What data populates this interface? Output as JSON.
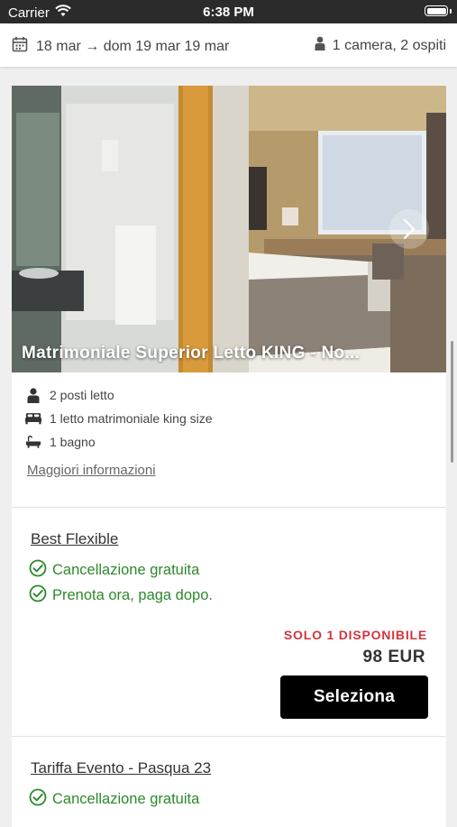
{
  "status_bar": {
    "carrier": "Carrier",
    "time": "6:38 PM"
  },
  "search": {
    "dates": "18 mar → dom 19 mar 19 mar",
    "guests": "1 camera, 2 ospiti"
  },
  "room": {
    "title": "Matrimoniale Superior Letto KING - No...",
    "features": [
      {
        "icon": "person-icon",
        "text": "2 posti letto"
      },
      {
        "icon": "bed-icon",
        "text": "1 letto matrimoniale king size"
      },
      {
        "icon": "bathtub-icon",
        "text": "1 bagno"
      }
    ],
    "more_info": "Maggiori informazioni"
  },
  "rates": [
    {
      "name": "Best Flexible",
      "benefits": [
        "Cancellazione gratuita",
        "Prenota ora, paga dopo."
      ],
      "availability": "SOLO 1 DISPONIBILE",
      "price": "98 EUR",
      "select_label": "Seleziona"
    },
    {
      "name": "Tariffa Evento - Pasqua 23",
      "benefits": [
        "Cancellazione gratuita"
      ]
    }
  ],
  "colors": {
    "accent_green": "#2c8a2c",
    "availability_red": "#d0363f",
    "button_black": "#000000"
  }
}
